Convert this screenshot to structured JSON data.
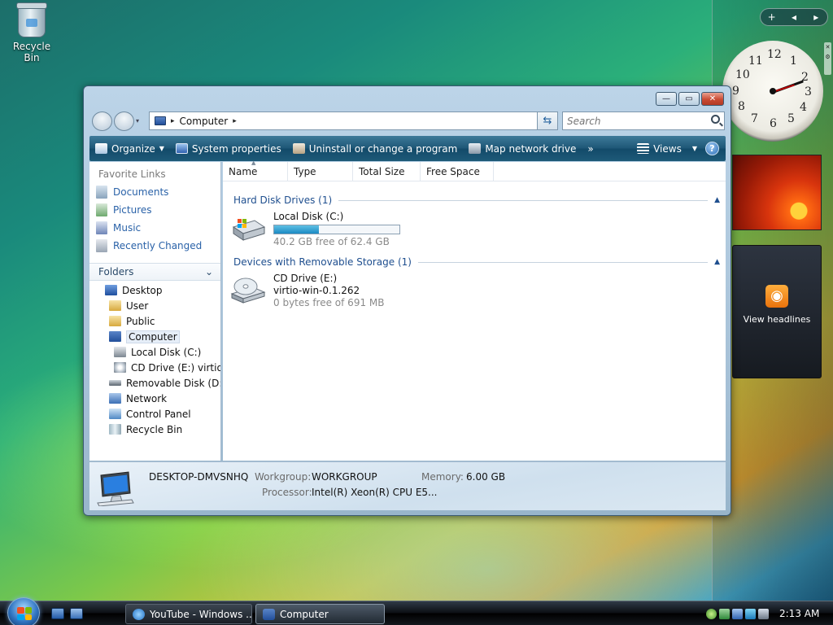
{
  "desktop": {
    "recycle_bin_label": "Recycle Bin"
  },
  "sidebar": {
    "controls": {
      "add": "+",
      "prev": "◂",
      "next": "▸"
    },
    "feeds_label": "View headlines"
  },
  "window": {
    "buttons": {
      "minimize": "—",
      "maximize": "▭",
      "close": "✕"
    },
    "address": {
      "crumb": "Computer",
      "separator": "▸"
    },
    "search": {
      "placeholder": "Search"
    },
    "toolbar": {
      "items": [
        {
          "label": "Organize",
          "has_dropdown": true,
          "icon": "organize-icon"
        },
        {
          "label": "System properties",
          "icon": "system-properties-icon"
        },
        {
          "label": "Uninstall or change a program",
          "icon": "uninstall-icon"
        },
        {
          "label": "Map network drive",
          "icon": "network-drive-icon"
        }
      ],
      "more": "»",
      "views_label": "Views",
      "help_label": "?"
    },
    "nav_pane": {
      "favorite_links_title": "Favorite Links",
      "favorites": [
        "Documents",
        "Pictures",
        "Music",
        "Recently Changed"
      ],
      "folders_label": "Folders",
      "tree": [
        {
          "label": "Desktop",
          "depth": 0
        },
        {
          "label": "User",
          "depth": 1
        },
        {
          "label": "Public",
          "depth": 1
        },
        {
          "label": "Computer",
          "depth": 1,
          "selected": true
        },
        {
          "label": "Local Disk (C:)",
          "depth": 2
        },
        {
          "label": "CD Drive (E:) virtio-w",
          "depth": 2
        },
        {
          "label": "Removable Disk (D:)",
          "depth": 1
        },
        {
          "label": "Network",
          "depth": 1
        },
        {
          "label": "Control Panel",
          "depth": 1
        },
        {
          "label": "Recycle Bin",
          "depth": 1
        }
      ]
    },
    "columns": [
      "Name",
      "Type",
      "Total Size",
      "Free Space"
    ],
    "groups": {
      "hard_disks": {
        "title": "Hard Disk Drives (1)",
        "drive": {
          "name": "Local Disk (C:)",
          "free_text": "40.2 GB free of 62.4 GB",
          "used_fraction": 0.36
        }
      },
      "removable": {
        "title": "Devices with Removable Storage (1)",
        "drive": {
          "name": "CD Drive (E:)",
          "volume": "virtio-win-0.1.262",
          "free_text": "0 bytes free of 691 MB"
        }
      }
    },
    "details": {
      "computer_name": "DESKTOP-DMVSNHQ",
      "workgroup_label": "Workgroup:",
      "workgroup_value": "WORKGROUP",
      "memory_label": "Memory:",
      "memory_value": "6.00 GB",
      "processor_label": "Processor:",
      "processor_value": "Intel(R) Xeon(R) CPU E5..."
    }
  },
  "taskbar": {
    "tasks": [
      {
        "label": "YouTube - Windows ...",
        "active": false
      },
      {
        "label": "Computer",
        "active": true
      }
    ],
    "time": "2:13 AM"
  },
  "colors": {
    "toolbar": "#1d5676",
    "link_blue": "#2a62a8",
    "group_header": "#1f4f8f",
    "capacity_fill": "#1b8ac3"
  }
}
